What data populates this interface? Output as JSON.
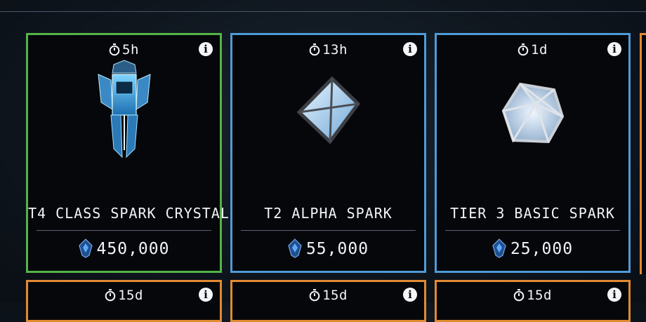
{
  "cards": [
    {
      "timer": "5h",
      "title": "T4 CLASS SPARK CRYSTAL",
      "price": "450,000",
      "border": "#55b447"
    },
    {
      "timer": "13h",
      "title": "T2 ALPHA SPARK",
      "price": "55,000",
      "border": "#4f9bd8"
    },
    {
      "timer": "1d",
      "title": "TIER 3 BASIC SPARK",
      "price": "25,000",
      "border": "#4f9bd8"
    }
  ],
  "next_row": [
    {
      "timer": "15d",
      "border": "#e08a32"
    },
    {
      "timer": "15d",
      "border": "#e08a32"
    },
    {
      "timer": "15d",
      "border": "#e08a32"
    }
  ],
  "icons": {
    "timer": "stopwatch-icon",
    "info": "info-icon",
    "currency": "crystal-currency-icon"
  }
}
